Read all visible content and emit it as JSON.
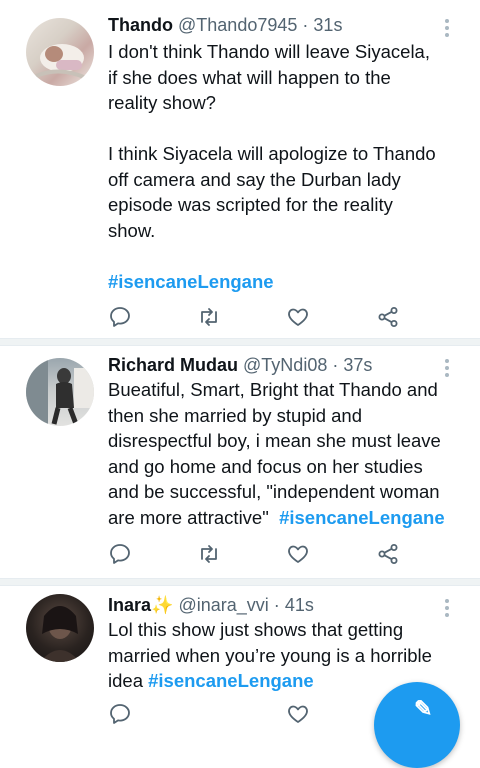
{
  "tweets": [
    {
      "name": "Thando",
      "handle": "@Thando7945",
      "dot": "·",
      "time": "31s",
      "avatar_icon": "user-avatar-icon",
      "lines": [
        "I don't think Thando will leave Siyacela,",
        "if she does what will happen to the",
        "reality show?",
        "",
        "I think Siyacela will apologize to Thando",
        "off camera and say the Durban lady",
        "episode was scripted for the reality",
        "show.",
        ""
      ],
      "hashtag": "#isencaneLengane"
    },
    {
      "name": "Richard Mudau",
      "handle": "@TyNdi08",
      "dot": "·",
      "time": "37s",
      "avatar_icon": "user-avatar-icon",
      "lines": [
        "Bueatiful, Smart, Bright that Thando and",
        "then she married by stupid and",
        "disrespectful boy, i mean she must leave",
        "and go home and focus on her studies",
        "and be successful, \"independent woman"
      ],
      "last_line": "are more attractive\"",
      "hashtag": "#isencaneLengane"
    },
    {
      "name": "Inara",
      "name_emoji": "✨",
      "handle": "@inara_vvi",
      "dot": "·",
      "time": "41s",
      "avatar_icon": "user-avatar-icon",
      "lines": [
        "Lol this show just shows that getting",
        "married when you’re young is a horrible"
      ],
      "last_line": "idea",
      "hashtag": "#isencaneLengane"
    }
  ],
  "icons": {
    "reply": "reply-icon",
    "retweet": "retweet-icon",
    "like": "heart-icon",
    "share": "share-icon",
    "compose": "compose-tweet-icon"
  },
  "colors": {
    "accent": "#1d9bf0",
    "text": "#0f1419",
    "secondary": "#536471",
    "separator": "#eff3f4"
  }
}
